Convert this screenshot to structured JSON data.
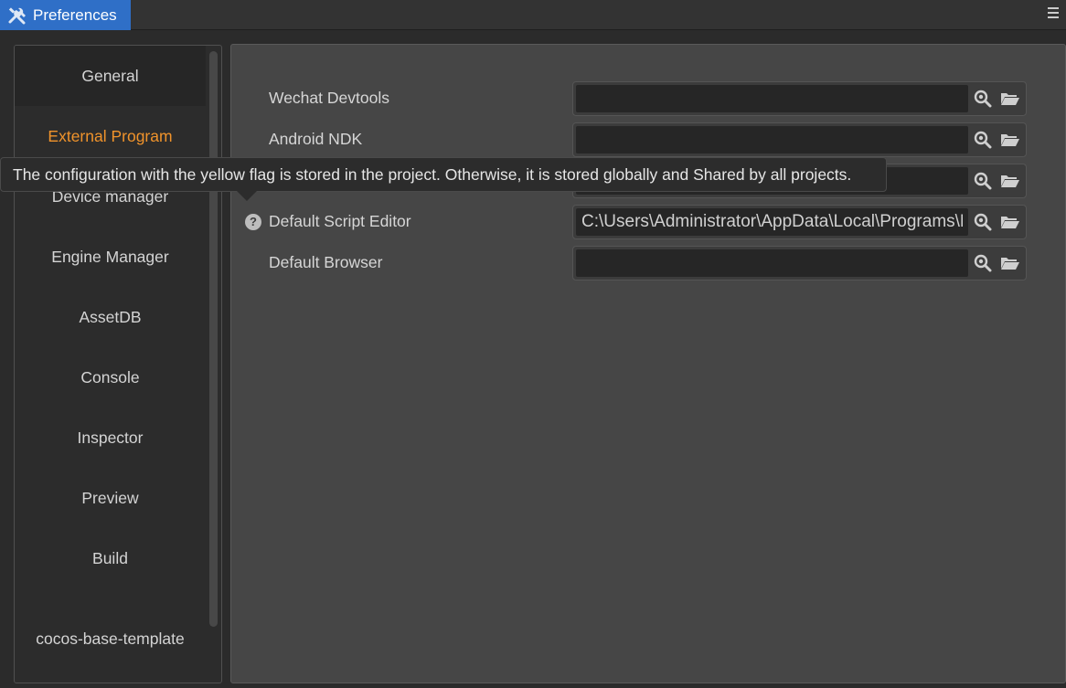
{
  "window": {
    "title": "Preferences",
    "title_icon": "tools-icon",
    "menu_icon": "hamburger-menu-icon",
    "accent_color": "#2f6fc7"
  },
  "sidebar": {
    "active_color": "#f0932b",
    "items": [
      {
        "label": "General"
      },
      {
        "label": "External Program"
      },
      {
        "label": "Device manager"
      },
      {
        "label": "Engine Manager"
      },
      {
        "label": "AssetDB"
      },
      {
        "label": "Console"
      },
      {
        "label": "Inspector"
      },
      {
        "label": "Preview"
      },
      {
        "label": "Build"
      },
      {
        "label": "cocos-base-template"
      }
    ],
    "active_item": "External Program"
  },
  "main": {
    "rows": [
      {
        "label": "Wechat Devtools",
        "value": ""
      },
      {
        "label": "Android NDK",
        "value": ""
      },
      {
        "label": "",
        "value": ""
      },
      {
        "label": "Default Script Editor",
        "value": "C:\\Users\\Administrator\\AppData\\Local\\Programs\\Microsoft VS Code\\Code.exe",
        "has_help": true
      },
      {
        "label": "Default Browser",
        "value": ""
      }
    ],
    "row_icons": [
      "search-icon",
      "folder-open-icon"
    ]
  },
  "tooltip": {
    "text": "The configuration with the yellow flag is stored in the project. Otherwise, it is stored globally and Shared by all projects."
  }
}
